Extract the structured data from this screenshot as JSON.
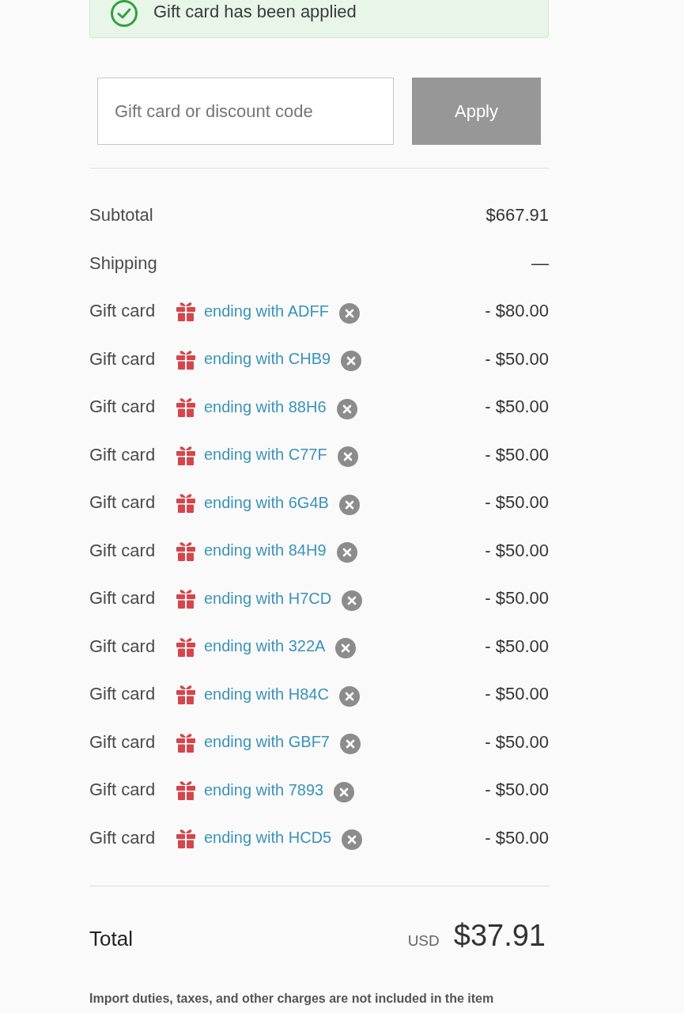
{
  "banner": {
    "message": "Gift card has been applied"
  },
  "discount": {
    "placeholder": "Gift card or discount code",
    "button": {
      "label": "Apply",
      "disabled": true
    }
  },
  "summary": [
    {
      "kind": "line",
      "label": "Subtotal",
      "value": "$667.91"
    },
    {
      "kind": "line",
      "label": "Shipping",
      "value": "—"
    },
    {
      "kind": "gift_card",
      "label": "Gift card",
      "code": "ending with ADFF",
      "value": "- $80.00"
    },
    {
      "kind": "gift_card",
      "label": "Gift card",
      "code": "ending with CHB9",
      "value": "- $50.00"
    },
    {
      "kind": "gift_card",
      "label": "Gift card",
      "code": "ending with 88H6",
      "value": "- $50.00"
    },
    {
      "kind": "gift_card",
      "label": "Gift card",
      "code": "ending with C77F",
      "value": "- $50.00"
    },
    {
      "kind": "gift_card",
      "label": "Gift card",
      "code": "ending with 6G4B",
      "value": "- $50.00"
    },
    {
      "kind": "gift_card",
      "label": "Gift card",
      "code": "ending with 84H9",
      "value": "- $50.00"
    },
    {
      "kind": "gift_card",
      "label": "Gift card",
      "code": "ending with H7CD",
      "value": "- $50.00"
    },
    {
      "kind": "gift_card",
      "label": "Gift card",
      "code": "ending with 322A",
      "value": "- $50.00"
    },
    {
      "kind": "gift_card",
      "label": "Gift card",
      "code": "ending with H84C",
      "value": "- $50.00"
    },
    {
      "kind": "gift_card",
      "label": "Gift card",
      "code": "ending with GBF7",
      "value": "- $50.00"
    },
    {
      "kind": "gift_card",
      "label": "Gift card",
      "code": "ending with 7893",
      "value": "- $50.00"
    },
    {
      "kind": "gift_card",
      "label": "Gift card",
      "code": "ending with HCD5",
      "value": "- $50.00"
    }
  ],
  "total": {
    "label": "Total",
    "currency": "USD",
    "amount": "$37.91"
  },
  "note": "Import duties, taxes, and other charges are not included in the item"
}
